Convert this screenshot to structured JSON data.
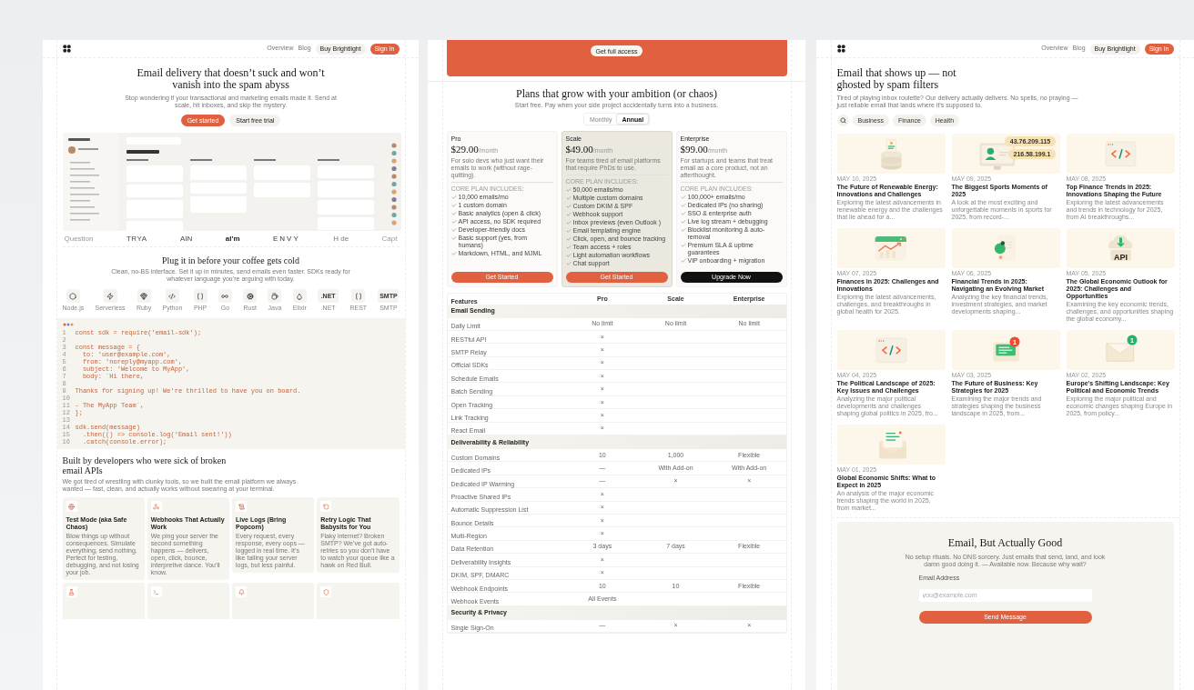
{
  "landing_page": {
    "nav": {
      "links": [
        "Overview",
        "Blog"
      ],
      "buy_button": "Buy Brightlight",
      "sign_in_button": "Sign In"
    },
    "hero": {
      "title": "Email delivery that doesn’t suck and won’t vanish into the spam abyss",
      "subtitle": "Stop wondering if your transactional and marketing emails made it. Send at scale, hit inboxes, and skip the mystery.",
      "primary_button": "Get started",
      "secondary_button": "Start free trial"
    },
    "logos": [
      "Question",
      "TRYA",
      "AIN",
      "al'm",
      "ENVY",
      "H de",
      "Capt"
    ],
    "sdk_section": {
      "title": "Plug it in before your coffee gets cold",
      "subtitle": "Clean, no-BS interface. Set it up in minutes, send emails even faster. SDKs ready for whatever language you’re arguing with today.",
      "sdks": [
        {
          "label": "Node.js"
        },
        {
          "label": "Serverless"
        },
        {
          "label": "Ruby"
        },
        {
          "label": "Python"
        },
        {
          "label": "PHP"
        },
        {
          "label": "Go"
        },
        {
          "label": "Rust"
        },
        {
          "label": "Java"
        },
        {
          "label": "Elixir"
        },
        {
          "label": ".NET",
          "glyph": ".NET"
        },
        {
          "label": "REST"
        },
        {
          "label": "SMTP",
          "glyph": "SMTP"
        }
      ]
    },
    "code": [
      {
        "n": "1",
        "text": "const sdk = require('email-sdk');"
      },
      {
        "n": "2"
      },
      {
        "n": "3",
        "text": "const message = {"
      },
      {
        "n": "4",
        "text": "  to: 'user@example.com',"
      },
      {
        "n": "5",
        "text": "  from: 'noreply@myapp.com',"
      },
      {
        "n": "6",
        "text": "  subject: 'Welcome to MyApp',"
      },
      {
        "n": "7",
        "text": "  body: `Hi there,"
      },
      {
        "n": "8"
      },
      {
        "n": "9",
        "text": "Thanks for signing up! We're thrilled to have you on board."
      },
      {
        "n": "10"
      },
      {
        "n": "11",
        "text": "- The MyApp Team`,"
      },
      {
        "n": "12",
        "text": "};"
      },
      {
        "n": "13"
      },
      {
        "n": "14",
        "text": "sdk.send(message)"
      },
      {
        "n": "15",
        "text": "  .then(() => console.log('Email sent!'))"
      },
      {
        "n": "16",
        "text": "  .catch(console.error);"
      }
    ],
    "features": {
      "title": "Built by developers who were sick of broken email APIs",
      "subtitle": "We got tired of wrestling with clunky tools, so we built the email platform we always wanted — fast, clean, and actually works without swearing at your terminal.",
      "cards": [
        {
          "kind": "full",
          "title": "Test Mode (aka Safe Chaos)",
          "text": "Blow things up without consequences. Simulate everything, send nothing. Perfect for testing, debugging, and not losing your job."
        },
        {
          "kind": "full",
          "title": "Webhooks That Actually Work",
          "text": "We ping your server the second something happens — delivers, open, click, bounce, interpretive dance. You’ll know."
        },
        {
          "kind": "full",
          "title": "Live Logs (Bring Popcorn)",
          "text": "Every request, every response, every oops — logged in real time. It’s like tailing your server logs, but less painful."
        },
        {
          "kind": "full",
          "title": "Retry Logic That Babysits for You",
          "text": "Flaky internet? Broken SMTP? We’ve got auto-retries so you don’t have to watch your queue like a hawk on Red Bull."
        },
        {
          "kind": "cut"
        },
        {
          "kind": "cut"
        },
        {
          "kind": "cut"
        },
        {
          "kind": "cut"
        }
      ]
    }
  },
  "pricing_page": {
    "banner": {
      "button": "Get full access"
    },
    "title": "Plans that grow with your ambition (or chaos)",
    "subtitle": "Start free. Pay when your side project accidentally turns into a business.",
    "billing_toggle": [
      {
        "label": "Monthly",
        "selected": false
      },
      {
        "label": "Annual",
        "selected": true
      }
    ],
    "plans": [
      {
        "name": "Pro",
        "price": "$29.00",
        "period": "/month",
        "description": "For solo devs who just want their emails to work (without rage-quitting).",
        "featured": false,
        "includes_label": "CORE PLAN INCLUDES:",
        "features": [
          "10,000 emails/mo",
          "1 custom domain",
          "Basic analytics (open & click)",
          "API access, no SDK required",
          "Developer-friendly docs",
          "Basic support (yes, from humans)",
          "Markdown, HTML, and MJML"
        ],
        "button": "Get Started"
      },
      {
        "name": "Scale",
        "price": "$49.00",
        "period": "/month",
        "description": "For teams tired of email platforms that require PhDs to use.",
        "featured": true,
        "includes_label": "CORE PLAN INCLUDES:",
        "features": [
          "50,000 emails/mo",
          "Multiple custom domains",
          "Custom DKIM & SPF",
          "Webhook support",
          "Inbox previews (even Outlook )",
          "Email templating engine",
          "Click, open, and bounce tracking",
          "Team access + roles",
          "Light automation workflows",
          "Chat support"
        ],
        "button": "Get Started"
      },
      {
        "name": "Enterprise",
        "price": "$99.00",
        "period": "/month",
        "description": "For startups and teams that treat email as a core product, not an afterthought.",
        "featured": false,
        "includes_label": "CORE PLAN INCLUDES:",
        "features": [
          "100,000+ emails/mo",
          "Dedicated IPs (no sharing)",
          "SSO & enterprise auth",
          "Live log stream + debugging",
          "Blocklist monitoring & auto-removal",
          "Premium SLA & uptime guarantees",
          "VIP onboarding + migration"
        ],
        "button": "Upgrade Now"
      }
    ],
    "comparison": {
      "columns": [
        "Features",
        "Pro",
        "Scale",
        "Enterprise"
      ],
      "sections": [
        {
          "title": "Email Sending",
          "rows": [
            {
              "feature": "Daily Limit",
              "pro": "No limit",
              "scale": "No limit",
              "enterprise": "No limit"
            },
            {
              "feature": "RESTful API",
              "pro": "×"
            },
            {
              "feature": "SMTP Relay",
              "pro": "×"
            },
            {
              "feature": "Official SDKs",
              "pro": "×"
            },
            {
              "feature": "Schedule Emails",
              "pro": "×"
            },
            {
              "feature": "Batch Sending",
              "pro": "×"
            },
            {
              "feature": "Open Tracking",
              "pro": "×"
            },
            {
              "feature": "Link Tracking",
              "pro": "×"
            },
            {
              "feature": "React Email",
              "pro": "×"
            }
          ]
        },
        {
          "title": "Deliverability & Reliability",
          "rows": [
            {
              "feature": "Custom Domains",
              "pro": "10",
              "scale": "1,000",
              "enterprise": "Flexible"
            },
            {
              "feature": "Dedicated IPs",
              "pro": "—",
              "scale": "With Add-on",
              "enterprise": "With Add-on"
            },
            {
              "feature": "Dedicated IP Warming",
              "pro": "—",
              "scale": "×",
              "enterprise": "×"
            },
            {
              "feature": "Proactive Shared IPs",
              "pro": "×"
            },
            {
              "feature": "Automatic Suppression List",
              "pro": "×"
            },
            {
              "feature": "Bounce Details",
              "pro": "×"
            },
            {
              "feature": "Multi-Region",
              "pro": "×"
            },
            {
              "feature": "Data Retention",
              "pro": "3 days",
              "scale": "7 days",
              "enterprise": "Flexible"
            },
            {
              "feature": "Deliverability Insights",
              "pro": "×"
            },
            {
              "feature": "DKIM, SPF, DMARC",
              "pro": "×"
            },
            {
              "feature": "Webhook Endpoints",
              "pro": "10",
              "scale": "10",
              "enterprise": "Flexible"
            },
            {
              "feature": "Webhook Events",
              "pro": "All Events"
            }
          ]
        },
        {
          "title": "Security & Privacy",
          "rows": [
            {
              "feature": "Single Sign-On",
              "pro": "—",
              "scale": "×",
              "enterprise": "×"
            }
          ]
        }
      ]
    }
  },
  "blog_page": {
    "nav": {
      "links": [
        "Overview",
        "Blog"
      ],
      "buy_button": "Buy Brightlight",
      "sign_in_button": "Sign In"
    },
    "title": "Email that shows up — not ghosted by spam filters",
    "subtitle": "Tired of playing inbox roulette? Our delivery actually delivers. No spells, no praying — just reliable email that lands where it’s supposed to.",
    "categories": [
      "Business",
      "Finance",
      "Health"
    ],
    "posts": [
      {
        "date": "MAY 10, 2025",
        "title": "The Future of Renewable Energy: Innovations and Challenges",
        "excerpt": "Exploring the latest advancements in renewable energy and the challenges that lie ahead for a..."
      },
      {
        "date": "MAY 09, 2025",
        "title": "The Biggest Sports Moments of 2025",
        "excerpt": "A look at the most exciting and unforgettable moments in sports for 2025, from record-...",
        "image_texts": [
          "43.76.209.115",
          "216.58.199.1"
        ]
      },
      {
        "date": "MAY 08, 2025",
        "title": "Top Finance Trends in 2025: Innovations Shaping the Future",
        "excerpt": "Exploring the latest advancements and trends in technology for 2025, from AI breakthroughs..."
      },
      {
        "date": "MAY 07, 2025",
        "title": "Finances in 2025: Challenges and Innovations",
        "excerpt": "Exploring the latest advancements, challenges, and breakthroughs in global health for 2025."
      },
      {
        "date": "MAY 06, 2025",
        "title": "Financial Trends in 2025: Navigating an Evolving Market",
        "excerpt": "Analyzing the key financial trends, investment strategies, and market developments shaping..."
      },
      {
        "date": "MAY 05, 2025",
        "title": "The Global Economic Outlook for 2025: Challenges and Opportunities",
        "excerpt": "Examining the key economic trends, challenges, and opportunities shaping the global economy...",
        "image_texts": [
          "API"
        ]
      },
      {
        "date": "MAY 04, 2025",
        "title": "The Political Landscape of 2025: Key Issues and Challenges",
        "excerpt": "Analyzing the major political developments and challenges shaping global politics in 2025, fro..."
      },
      {
        "date": "MAY 03, 2025",
        "title": "The Future of Business: Key Strategies for 2025",
        "excerpt": "Examining the major trends and strategies shaping the business landscape in 2025, from...",
        "image_texts": [
          "1"
        ]
      },
      {
        "date": "MAY 02, 2025",
        "title": "Europe's Shifting Landscape: Key Political and Economic Trends",
        "excerpt": "Exploring the major political and economic changes shaping Europe in 2025, from policy...",
        "image_texts": [
          "1"
        ]
      },
      {
        "date": "MAY 01, 2025",
        "title": "Global Economic Shifts: What to Expect in 2025",
        "excerpt": "An analysis of the major economic trends shaping the world in 2025, from market..."
      }
    ],
    "cta": {
      "title": "Email, But Actually Good",
      "text": "No setup rituals. No DNS sorcery. Just emails that send, land, and look damn good doing it. — Available now. Because why wait?",
      "field_label": "Email Address",
      "placeholder": "you@example.com",
      "button": "Send Message"
    }
  }
}
